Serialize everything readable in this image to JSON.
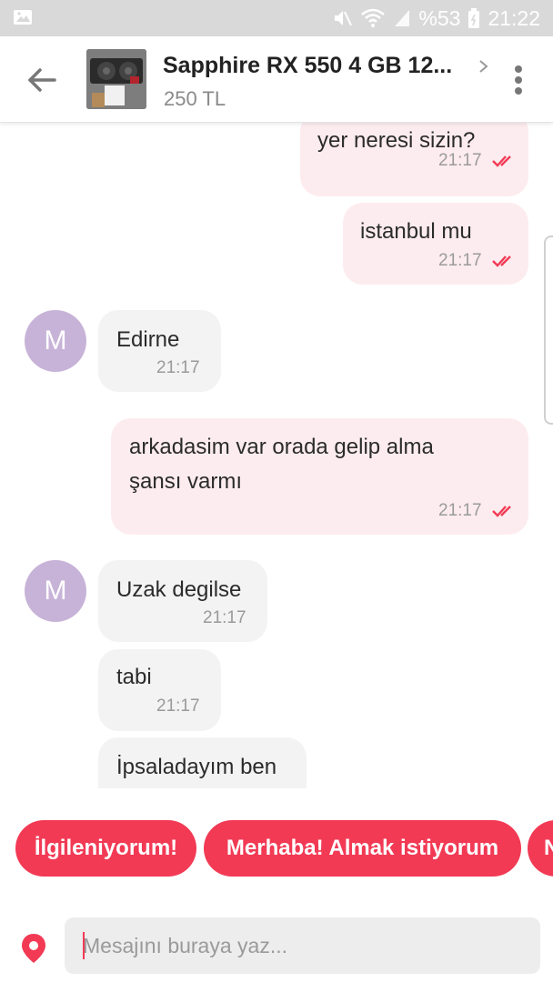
{
  "status_bar": {
    "battery_percent": "%53",
    "time": "21:22",
    "icons": [
      "image-icon",
      "mute-icon",
      "wifi-icon",
      "signal-icon",
      "battery-icon"
    ]
  },
  "header": {
    "title": "Sapphire RX 550 4 GB  12...",
    "price": "250 TL",
    "icons": [
      "back-arrow-icon",
      "chevron-right-icon",
      "more-vert-icon"
    ]
  },
  "messages": [
    {
      "dir": "out",
      "text": "yer neresi sizin?",
      "time": "21:17",
      "read": true
    },
    {
      "dir": "out",
      "text": "istanbul mu",
      "time": "21:17",
      "read": true
    },
    {
      "dir": "in",
      "avatar": "M",
      "text": "Edirne",
      "time": "21:17"
    },
    {
      "dir": "out",
      "text": "arkadasim var orada gelip alma şansı varmı",
      "time": "21:17",
      "read": true
    },
    {
      "dir": "in",
      "avatar": "M",
      "text": "Uzak degilse",
      "time": "21:17"
    },
    {
      "dir": "in",
      "text": "tabi",
      "time": "21:17"
    },
    {
      "dir": "in",
      "text": "İpsaladayım ben",
      "time": ""
    }
  ],
  "quick_replies": [
    "İlgileniyorum!",
    "Merhaba! Almak istiyorum",
    "N"
  ],
  "composer": {
    "placeholder": "Mesajını buraya yaz..."
  },
  "colors": {
    "accent": "#f23a55",
    "outgoing_bubble": "#fdecef",
    "incoming_bubble": "#f3f3f3",
    "avatar": "#c8b3d8",
    "status_bar": "#d9d9d9"
  }
}
